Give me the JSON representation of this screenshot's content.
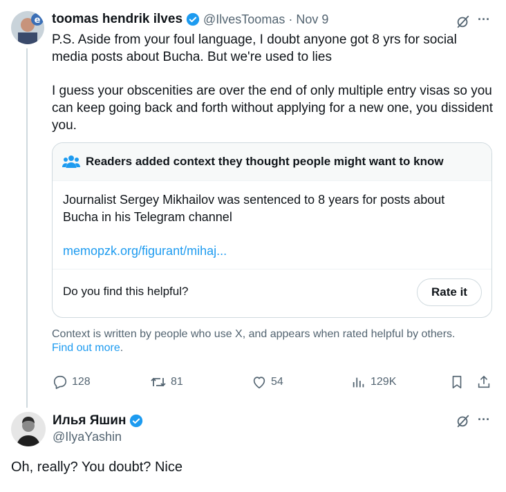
{
  "tweet1": {
    "name": "toomas hendrik ilves",
    "handle": "@IlvesToomas",
    "sep": "·",
    "date": "Nov 9",
    "more": "···",
    "para1": "P.S. Aside from your foul language, I doubt anyone got 8 yrs for social media posts about Bucha. But we're used to lies",
    "para2": "I guess your obscenities are over the end of only multiple entry visas so you can keep going back and forth without applying for a new one, you dissident you.",
    "note": {
      "header": "Readers added context they thought people might want to know",
      "body": "Journalist Sergey Mikhailov was sentenced to 8 years for posts about Bucha in his Telegram channel",
      "link": "memopzk.org/figurant/mihaj...",
      "question": "Do you find this helpful?",
      "rate_label": "Rate it"
    },
    "context_text": "Context is written by people who use X, and appears when rated helpful by others.",
    "find_out_more": "Find out more",
    "find_out_more_suffix": ".",
    "actions": {
      "replies": "128",
      "reposts": "81",
      "likes": "54",
      "views": "129K"
    }
  },
  "tweet2": {
    "name": "Илья Яшин",
    "handle": "@IlyaYashin",
    "more": "···",
    "text": "Oh, really? You doubt? Nice"
  },
  "colors": {
    "verified": "#1d9bf0",
    "link": "#1d9bf0",
    "muted": "#536471",
    "border": "#cfd9de"
  }
}
